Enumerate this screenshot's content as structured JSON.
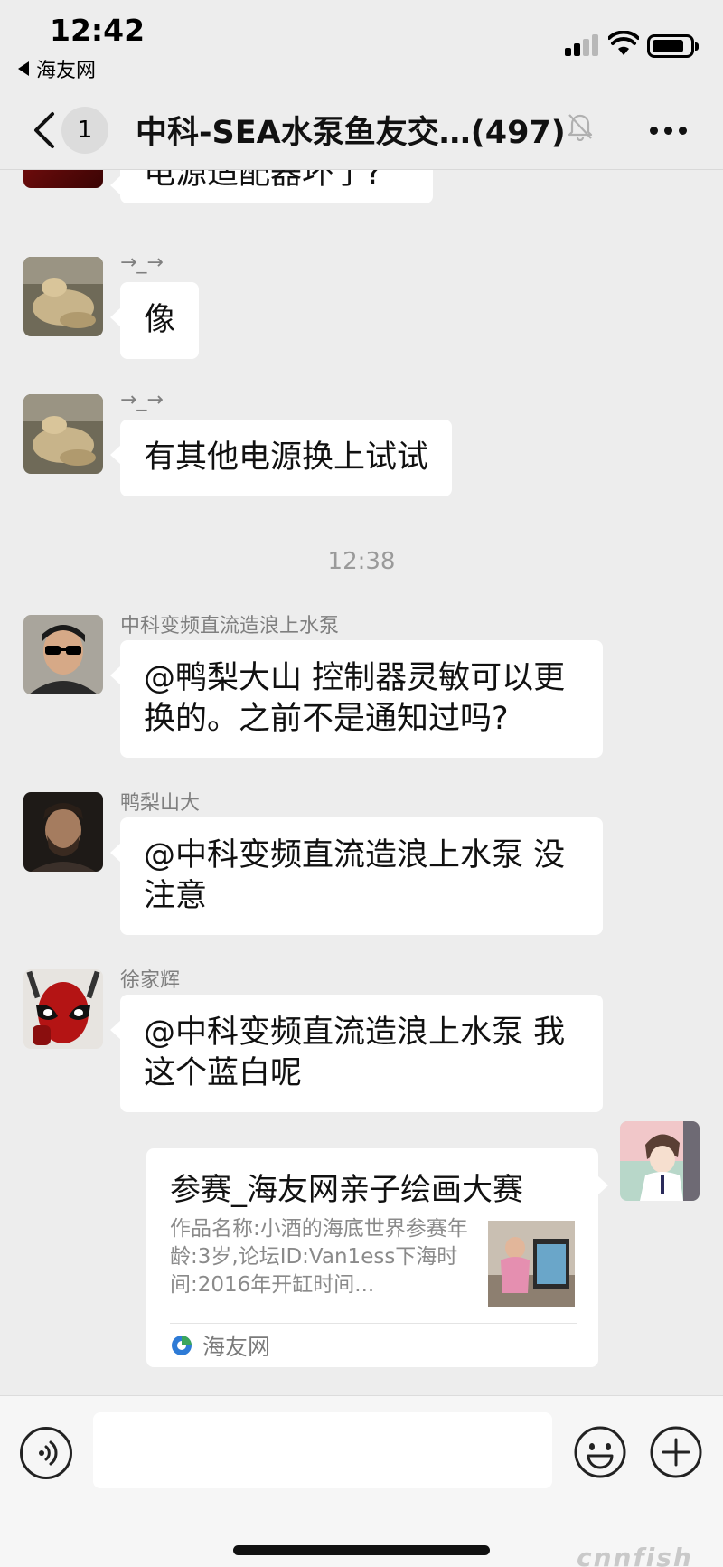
{
  "status_bar": {
    "time": "12:42",
    "back_app": "海友网"
  },
  "header": {
    "unread_count": "1",
    "title": "中科-SEA水泵鱼友交…(497)"
  },
  "messages": [
    {
      "text": "电源适配器坏了?"
    },
    {
      "sender": "→_→",
      "text": "像"
    },
    {
      "sender": "→_→",
      "text": "有其他电源换上试试"
    },
    {
      "timestamp": "12:38"
    },
    {
      "sender": "中科变频直流造浪上水泵",
      "text": "@鸭梨大山 控制器灵敏可以更换的。之前不是通知过吗?"
    },
    {
      "sender": "鸭梨山大",
      "text": "@中科变频直流造浪上水泵 没注意"
    },
    {
      "sender": "徐家辉",
      "text": "@中科变频直流造浪上水泵 我这个蓝白呢"
    }
  ],
  "link_card": {
    "title": "参赛_海友网亲子绘画大赛",
    "description": "作品名称:小酒的海底世界参赛年龄:3岁,论坛ID:Van1ess下海时间:2016年开缸时间...",
    "source": "海友网"
  },
  "input_bar": {
    "placeholder": ""
  },
  "watermark": "cnnfish",
  "colors": {
    "background": "#ededed",
    "bubble": "#ffffff",
    "source_icon": "#2e7bd6"
  }
}
